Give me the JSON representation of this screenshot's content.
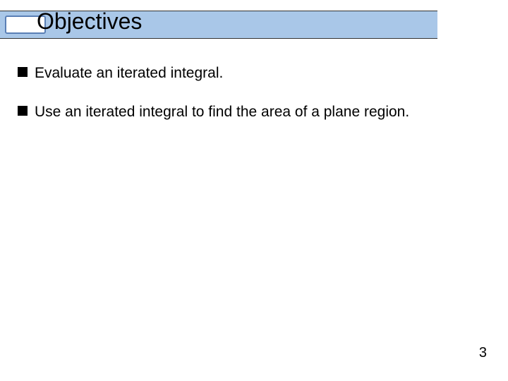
{
  "header": {
    "title": "Objectives"
  },
  "bullets": [
    {
      "text": "Evaluate an iterated integral."
    },
    {
      "text": "Use an iterated integral to find the area of a plane region."
    }
  ],
  "footer": {
    "page_number": "3"
  }
}
